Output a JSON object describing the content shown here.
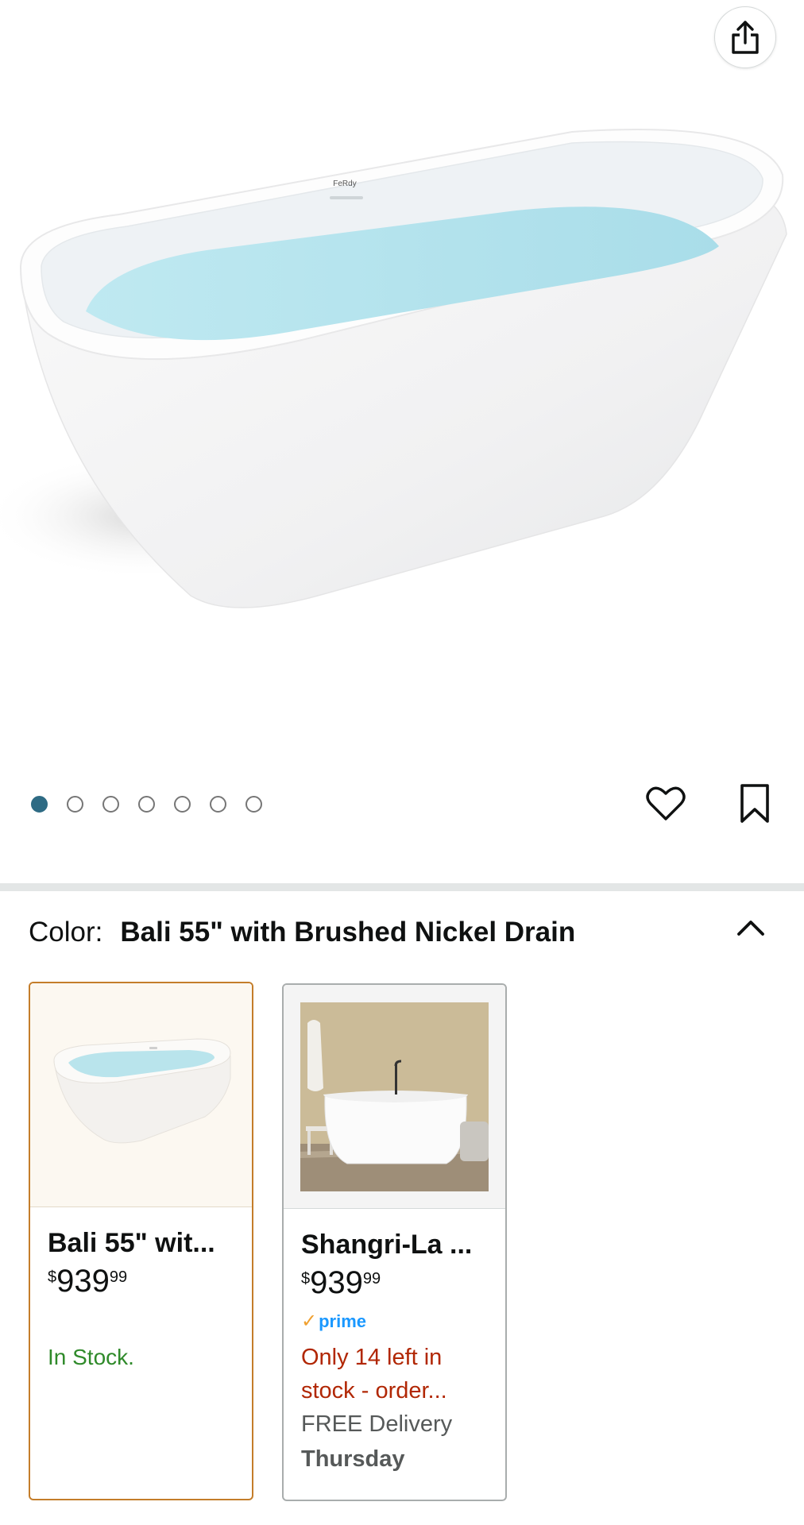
{
  "header": {
    "share_icon": "share-icon"
  },
  "gallery": {
    "brand_mark": "FeRdy",
    "image_count": 7,
    "active_index": 0,
    "dot_color_active": "#2e6b84",
    "wishlist_icon": "heart-icon",
    "save_icon": "bookmark-icon"
  },
  "variation": {
    "label": "Color:",
    "selected_value": "Bali 55\" with Brushed Nickel Drain",
    "collapse_icon": "chevron-up-icon"
  },
  "variants": [
    {
      "title": "Bali 55\" wit...",
      "price_symbol": "$",
      "price_whole": "939",
      "price_fraction": "99",
      "availability": "In Stock.",
      "selected": true,
      "border_color": "#c47d2a"
    },
    {
      "title": "Shangri-La ...",
      "price_symbol": "$",
      "price_whole": "939",
      "price_fraction": "99",
      "prime_label": "prime",
      "availability": "Only 14 left in stock - order...",
      "delivery_line": "FREE Delivery",
      "delivery_day": "Thursday",
      "selected": false
    }
  ]
}
